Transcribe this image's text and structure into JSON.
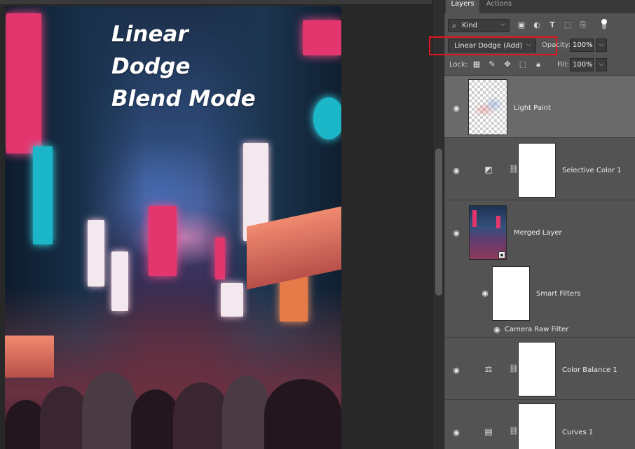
{
  "overlay_title": "Linear\nDodge\nBlend Mode",
  "panel": {
    "tabs": [
      {
        "label": "Layers",
        "active": true
      },
      {
        "label": "Actions",
        "active": false
      }
    ],
    "filter": {
      "kind_label": "Kind",
      "icons": [
        "image-filter-icon",
        "adjustment-filter-icon",
        "type-filter-icon",
        "shape-filter-icon",
        "smart-object-filter-icon"
      ]
    },
    "blend_mode": {
      "value": "Linear Dodge (Add)",
      "highlight_color": "#e0141e"
    },
    "opacity": {
      "label": "Opacity:",
      "value": "100%"
    },
    "lock": {
      "label": "Lock:",
      "icons": [
        "lock-transparent-pixels-icon",
        "lock-image-pixels-icon",
        "lock-position-icon",
        "lock-artboard-icon",
        "lock-all-icon"
      ]
    },
    "fill": {
      "label": "Fill:",
      "value": "100%"
    },
    "layers": [
      {
        "name": "Light Paint",
        "type": "pixel",
        "visible": true,
        "selected": true
      },
      {
        "name": "Selective Color 1",
        "type": "adjustment",
        "visible": true,
        "selected": false
      },
      {
        "name": "Merged Layer",
        "type": "smart-object",
        "visible": true,
        "selected": false
      },
      {
        "name": "Smart Filters",
        "type": "smart-filters",
        "visible": true,
        "selected": false
      },
      {
        "name": "Camera Raw Filter",
        "type": "filter",
        "visible": true,
        "selected": false
      },
      {
        "name": "Color Balance 1",
        "type": "adjustment",
        "visible": true,
        "selected": false
      },
      {
        "name": "Curves 1",
        "type": "adjustment",
        "visible": true,
        "selected": false
      }
    ]
  },
  "colors": {
    "panel_bg": "#535353",
    "selected_row": "#6a6a6a",
    "canvas_bg": "#282828"
  }
}
